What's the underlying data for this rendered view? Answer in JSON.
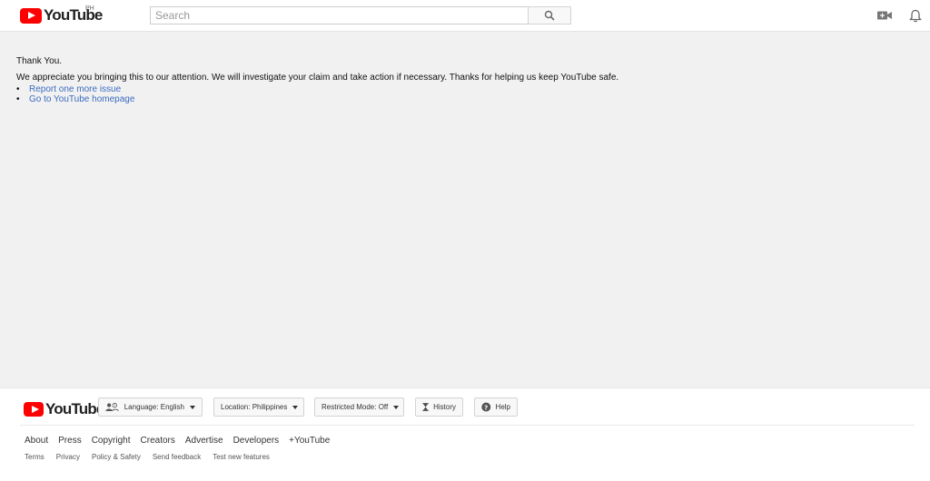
{
  "header": {
    "logo_text": "YouTube",
    "country_code": "PH",
    "search_placeholder": "Search"
  },
  "content": {
    "title": "Thank You.",
    "message": "We appreciate you bringing this to our attention. We will investigate your claim and take action if necessary. Thanks for helping us keep YouTube safe.",
    "links": [
      {
        "label": "Report one more issue"
      },
      {
        "label": "Go to YouTube homepage"
      }
    ]
  },
  "footer": {
    "logo_text": "YouTube",
    "language_label": "Language: English",
    "location_label": "Location: Philippines",
    "restricted_label": "Restricted Mode: Off",
    "history_label": "History",
    "help_label": "Help",
    "primary_links": [
      "About",
      "Press",
      "Copyright",
      "Creators",
      "Advertise",
      "Developers",
      "+YouTube"
    ],
    "secondary_links": [
      "Terms",
      "Privacy",
      "Policy & Safety",
      "Send feedback",
      "Test new features"
    ]
  },
  "colors": {
    "brand_red": "#ff0000",
    "link_blue": "#3a6cc2",
    "page_bg": "#f1f1f1"
  },
  "icons": {
    "search": "magnifier-icon",
    "upload": "video-camera-icon",
    "notifications": "bell-icon",
    "language": "people-icon",
    "history": "hourglass-icon",
    "help": "question-circle-icon"
  }
}
